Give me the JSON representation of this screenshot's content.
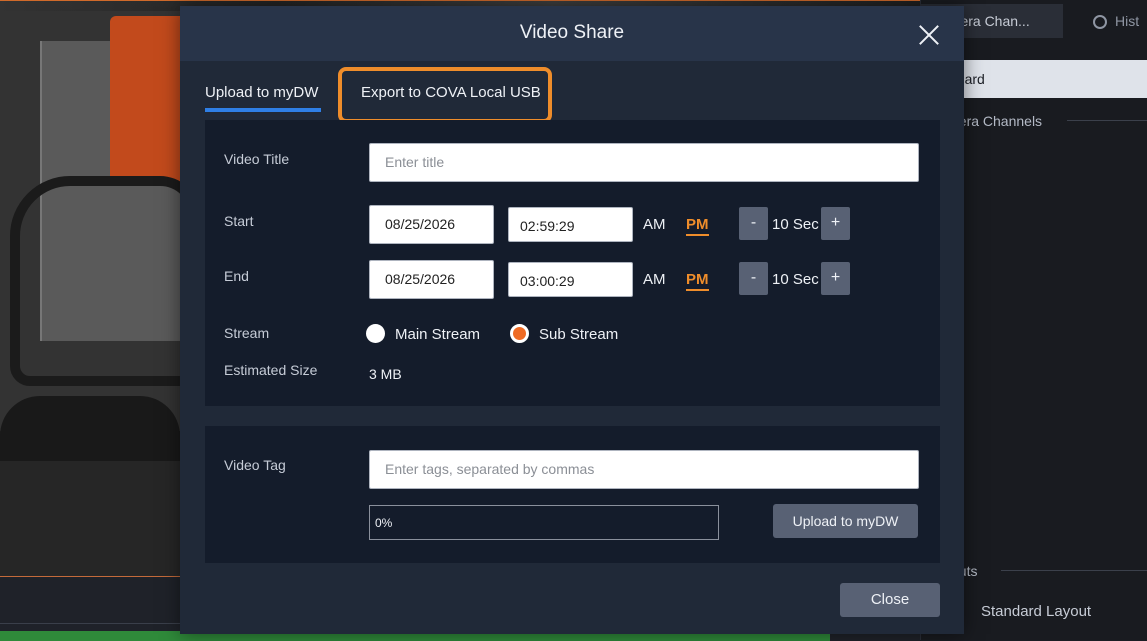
{
  "background_tabs": {
    "camera_channels_tab": "amera Chan...",
    "history_tab": "Hist",
    "selected_mode": "ndard",
    "section_camera_channels": "nera Channels",
    "section_layouts": "outs",
    "layout_item": "Standard Layout"
  },
  "modal": {
    "title": "Video Share",
    "tabs": {
      "upload_label": "Upload to myDW",
      "usb_label": "Export to COVA Local USB"
    },
    "form": {
      "video_title_label": "Video Title",
      "video_title_placeholder": "Enter title",
      "video_title_value": "",
      "start_label": "Start",
      "start_date": "08/25/2026",
      "start_time": "02:59:29",
      "start_am": "AM",
      "start_pm": "PM",
      "start_step_minus": "-",
      "start_step_value": "10 Sec",
      "start_step_plus": "+",
      "end_label": "End",
      "end_date": "08/25/2026",
      "end_time": "03:00:29",
      "end_am": "AM",
      "end_pm": "PM",
      "end_step_minus": "-",
      "end_step_value": "10 Sec",
      "end_step_plus": "+",
      "stream_label": "Stream",
      "stream_main": "Main Stream",
      "stream_sub": "Sub Stream",
      "stream_selected": "Sub Stream",
      "estimated_size_label": "Estimated Size",
      "estimated_size_value": "3 MB"
    },
    "tags": {
      "video_tag_label": "Video Tag",
      "tags_placeholder": "Enter tags, separated by commas",
      "progress_text": "0%",
      "progress_fraction": 0,
      "upload_button": "Upload to myDW"
    },
    "close_button": "Close"
  },
  "colors": {
    "accent_blue": "#2f7fe6",
    "accent_orange": "#ef8d2b",
    "modal_bg": "#202938",
    "panel_bg": "#141c2b"
  }
}
